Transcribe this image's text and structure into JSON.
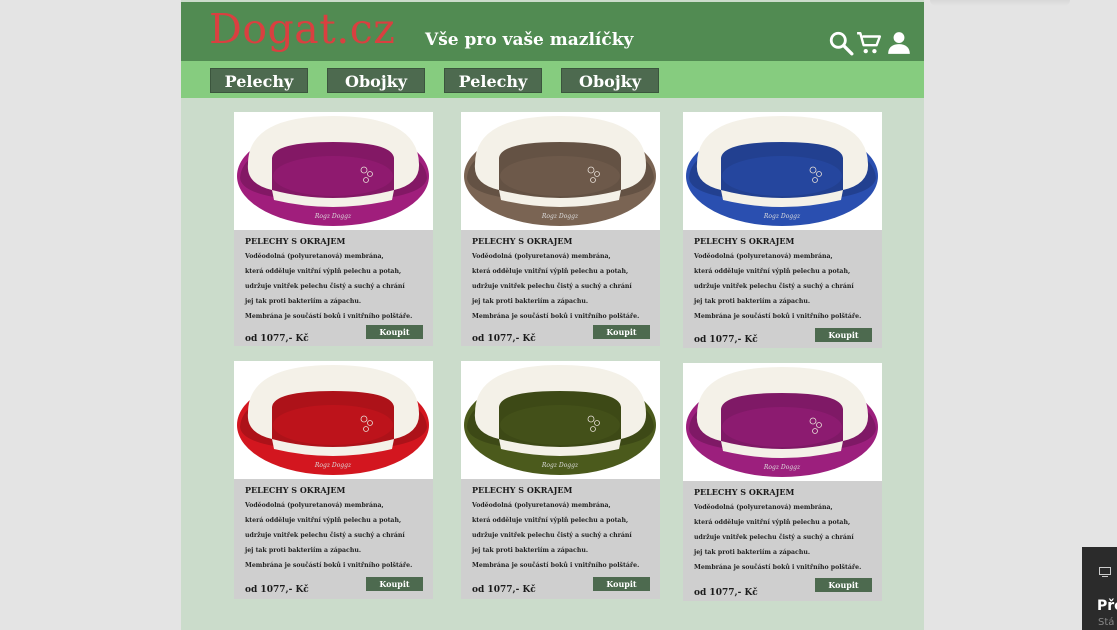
{
  "header": {
    "logo": "Dogat.cz",
    "tagline": "Vše pro vaše mazlíčky",
    "icons": [
      "search-icon",
      "cart-icon",
      "user-icon"
    ]
  },
  "nav": {
    "items": [
      {
        "label": "Pelechy"
      },
      {
        "label": "Obojky"
      },
      {
        "label": "Pelechy"
      },
      {
        "label": "Obojky"
      }
    ]
  },
  "products": [
    {
      "title": "PELECHY S OKRAJEM",
      "desc": [
        "Voděodolná (polyuretanová) membrána,",
        " která odděluje vnitřní výplň pelechu a potah,",
        "udržuje vnitřek pelechu čistý a suchý a chrání",
        " jej tak proti bakteriím a zápachu.",
        "Membrána je součástí boků i vnitřního polštáře."
      ],
      "price": "od 1077,- Kč",
      "buy_label": "Koupit",
      "color": "#a01e7c"
    },
    {
      "title": "PELECHY S OKRAJEM",
      "desc": [
        "Voděodolná (polyuretanová) membrána,",
        " která odděluje vnitřní výplň pelechu a potah,",
        "udržuje vnitřek pelechu čistý a suchý a chrání",
        " jej tak proti bakteriím a zápachu.",
        "Membrána je součástí boků i vnitřního polštáře."
      ],
      "price": "od 1077,- Kč",
      "buy_label": "Koupit",
      "color": "#7a6453"
    },
    {
      "title": "PELECHY S OKRAJEM",
      "desc": [
        "Voděodolná (polyuretanová) membrána,",
        " která odděluje vnitřní výplň pelechu a potah,",
        "udržuje vnitřek pelechu čistý a suchý a chrání",
        " jej tak proti bakteriím a zápachu.",
        "Membrána je součástí boků i vnitřního polštáře."
      ],
      "price": "od 1077,- Kč",
      "buy_label": "Koupit",
      "color": "#2a4fb0"
    },
    {
      "title": "PELECHY S OKRAJEM",
      "desc": [
        "Voděodolná (polyuretanová) membrána,",
        " která odděluje vnitřní výplň pelechu a potah,",
        "udržuje vnitřek pelechu čistý a suchý a chrání",
        " jej tak proti bakteriím a zápachu.",
        "Membrána je součástí boků i vnitřního polštáře."
      ],
      "price": "od 1077,- Kč",
      "buy_label": "Koupit",
      "color": "#d3161f"
    },
    {
      "title": "PELECHY S OKRAJEM",
      "desc": [
        "Voděodolná (polyuretanová) membrána,",
        " která odděluje vnitřní výplň pelechu a potah,",
        "udržuje vnitřek pelechu čistý a suchý a chrání",
        " jej tak proti bakteriím a zápachu.",
        "Membrána je součástí boků i vnitřního polštáře."
      ],
      "price": "od 1077,- Kč",
      "buy_label": "Koupit",
      "color": "#4b5a1c"
    },
    {
      "title": "PELECHY S OKRAJEM",
      "desc": [
        "Voděodolná (polyuretanová) membrána,",
        " která odděluje vnitřní výplň pelechu a potah,",
        "udržuje vnitřek pelechu čistý a suchý a chrání",
        " jej tak proti bakteriím a zápachu.",
        "Membrána je součástí boků i vnitřního polštáře."
      ],
      "price": "od 1077,- Kč",
      "buy_label": "Koupit",
      "color": "#9c1f7d"
    }
  ],
  "side_panel": {
    "title": "Pře",
    "subtitle": "Stá",
    "icon": "screen-icon"
  }
}
